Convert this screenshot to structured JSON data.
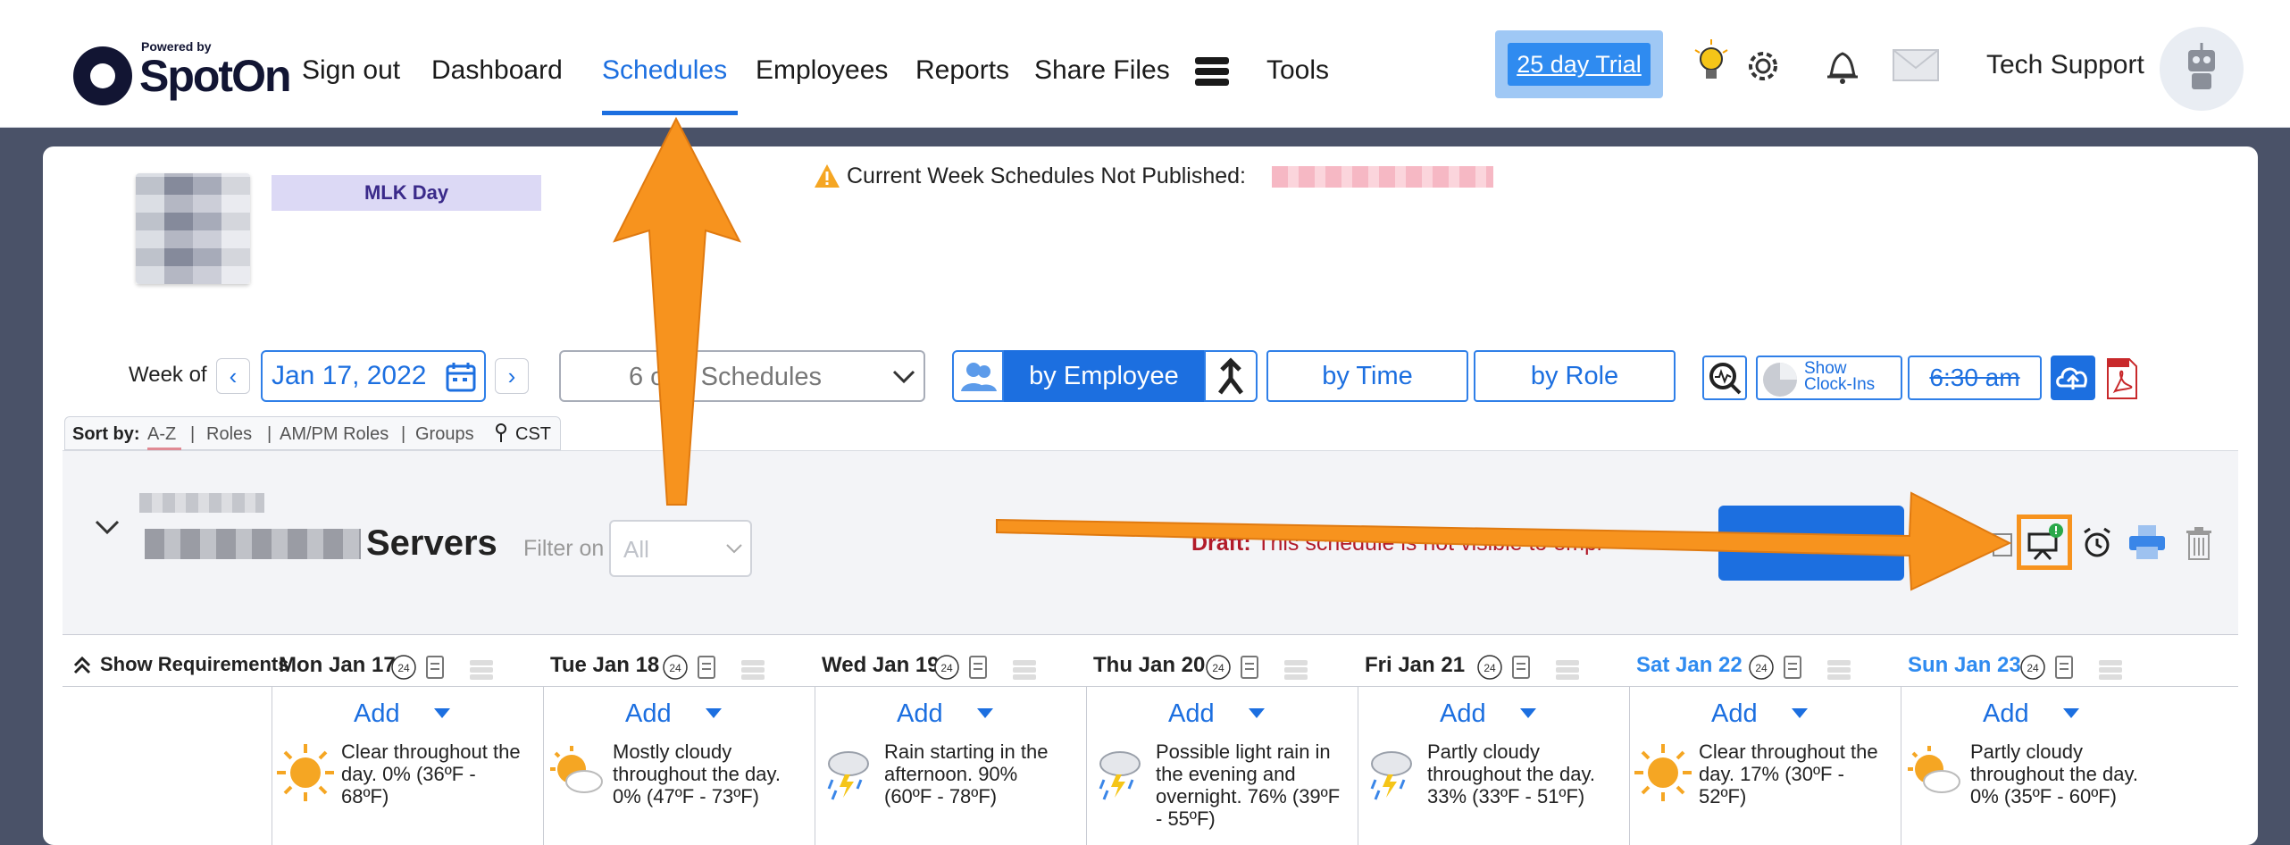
{
  "brand": {
    "powered_by": "Powered by",
    "name": "SpotOn"
  },
  "nav": {
    "sign_out": "Sign out",
    "dashboard": "Dashboard",
    "schedules": "Schedules",
    "employees": "Employees",
    "reports": "Reports",
    "share_files": "Share Files",
    "tools": "Tools"
  },
  "trial": {
    "label": "25 day Trial"
  },
  "user": {
    "name": "Tech Support"
  },
  "warning": {
    "text": "Current Week Schedules Not Published:"
  },
  "week": {
    "label": "Week of",
    "date": "Jan 17, 2022",
    "prev": "‹",
    "next": "›"
  },
  "schedules_select": {
    "value": "6 of 9 Schedules"
  },
  "view_buttons": {
    "by_employee": "by Employee",
    "by_time": "by Time",
    "by_role": "by Role"
  },
  "clock_ins": {
    "line1": "Show",
    "line2": "Clock-Ins"
  },
  "time_filter": "6:30 am",
  "sort": {
    "label": "Sort by:",
    "options": [
      "A-Z",
      "Roles",
      "AM/PM Roles",
      "Groups"
    ],
    "separator": "|",
    "timezone": "CST"
  },
  "group": {
    "name": "Servers",
    "filter_label": "Filter on",
    "filter_value": "All",
    "draft_label": "Draft:",
    "draft_text": "This schedule is not visible to empl"
  },
  "grid": {
    "show_requirements": "Show Requirements",
    "add_label": "Add",
    "days": [
      {
        "label": "Mon Jan 17",
        "weekend": false,
        "weather": "Clear throughout the day. 0% (36ºF - 68ºF)",
        "icon": "sun-icon",
        "holiday": "MLK Day"
      },
      {
        "label": "Tue Jan 18",
        "weekend": false,
        "weather": "Mostly cloudy throughout the day. 0% (47ºF - 73ºF)",
        "icon": "partly-cloudy-icon",
        "holiday": ""
      },
      {
        "label": "Wed Jan 19",
        "weekend": false,
        "weather": "Rain starting in the afternoon. 90% (60ºF - 78ºF)",
        "icon": "rain-icon",
        "holiday": ""
      },
      {
        "label": "Thu Jan 20",
        "weekend": false,
        "weather": "Possible light rain in the evening and overnight. 76% (39ºF - 55ºF)",
        "icon": "rain-icon",
        "holiday": ""
      },
      {
        "label": "Fri Jan 21",
        "weekend": false,
        "weather": "Partly cloudy throughout the day. 33% (33ºF - 51ºF)",
        "icon": "rain-icon",
        "holiday": ""
      },
      {
        "label": "Sat Jan 22",
        "weekend": true,
        "weather": "Clear throughout the day. 17% (30ºF - 52ºF)",
        "icon": "sun-icon",
        "holiday": ""
      },
      {
        "label": "Sun Jan 23",
        "weekend": true,
        "weather": "Partly cloudy throughout the day. 0% (35ºF - 60ºF)",
        "icon": "partly-cloudy-icon",
        "holiday": ""
      }
    ],
    "badge_24": "24"
  },
  "colors": {
    "accent": "#1c6fe0",
    "annotation": "#f7931e",
    "draft": "#b11a2a",
    "holiday_bg": "#dcd9f5"
  }
}
